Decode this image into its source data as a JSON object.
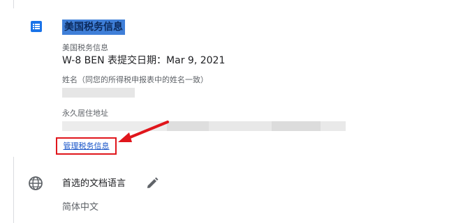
{
  "tax_section": {
    "title": "美国税务信息",
    "icon": "list-icon",
    "subtitle": "美国税务信息",
    "submission": "W-8 BEN 表提交日期：Mar 9, 2021",
    "name_label": "姓名（同您的所得税申报表中的姓名一致）",
    "address_label": "永久居住地址",
    "manage_link": "管理税务信息"
  },
  "language_section": {
    "icon": "globe-icon",
    "title": "首选的文档语言",
    "edit_icon": "pencil-icon",
    "value": "简体中文"
  },
  "annotation": {
    "highlight_color": "#e0161c"
  }
}
